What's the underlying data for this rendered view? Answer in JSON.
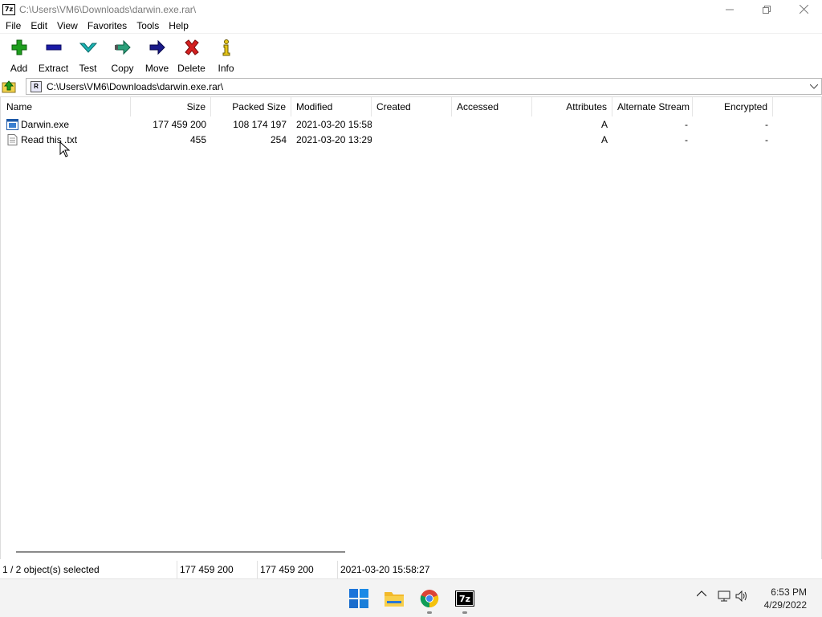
{
  "window": {
    "title": "C:\\Users\\VM6\\Downloads\\darwin.exe.rar\\",
    "app_icon_text": "7z",
    "controls": [
      "minimize",
      "restore",
      "close"
    ]
  },
  "menu": [
    "File",
    "Edit",
    "View",
    "Favorites",
    "Tools",
    "Help"
  ],
  "toolbar": {
    "add": "Add",
    "extract": "Extract",
    "test": "Test",
    "copy": "Copy",
    "move": "Move",
    "delete": "Delete",
    "info": "Info"
  },
  "address": {
    "path": "C:\\Users\\VM6\\Downloads\\darwin.exe.rar\\"
  },
  "columns": [
    "Name",
    "Size",
    "Packed Size",
    "Modified",
    "Created",
    "Accessed",
    "Attributes",
    "Alternate Stream",
    "Encrypted"
  ],
  "files": [
    {
      "name": "Darwin.exe",
      "size": "177 459 200",
      "packed": "108 174 197",
      "modified": "2021-03-20 15:58",
      "created": "",
      "accessed": "",
      "attributes": "A",
      "alt_stream": "-",
      "encrypted": "-",
      "icon": "exe-icon"
    },
    {
      "name": "Read this .txt",
      "size": "455",
      "packed": "254",
      "modified": "2021-03-20 13:29",
      "created": "",
      "accessed": "",
      "attributes": "A",
      "alt_stream": "-",
      "encrypted": "-",
      "icon": "text-file-icon"
    }
  ],
  "status": {
    "selection": "1 / 2 object(s) selected",
    "size": "177 459 200",
    "packed": "177 459 200",
    "modified": "2021-03-20 15:58:27"
  },
  "taskbar": {
    "apps": [
      "windows-start-icon",
      "file-explorer-icon",
      "chrome-icon",
      "7zip-icon"
    ],
    "time": "6:53 PM",
    "date": "4/29/2022"
  },
  "colors": {
    "add_green": "#1e9e1e",
    "extract_blue": "#1a1aa6",
    "test_teal": "#1bb3b3",
    "delete_red": "#d42020",
    "info_yellow": "#e6c619"
  }
}
